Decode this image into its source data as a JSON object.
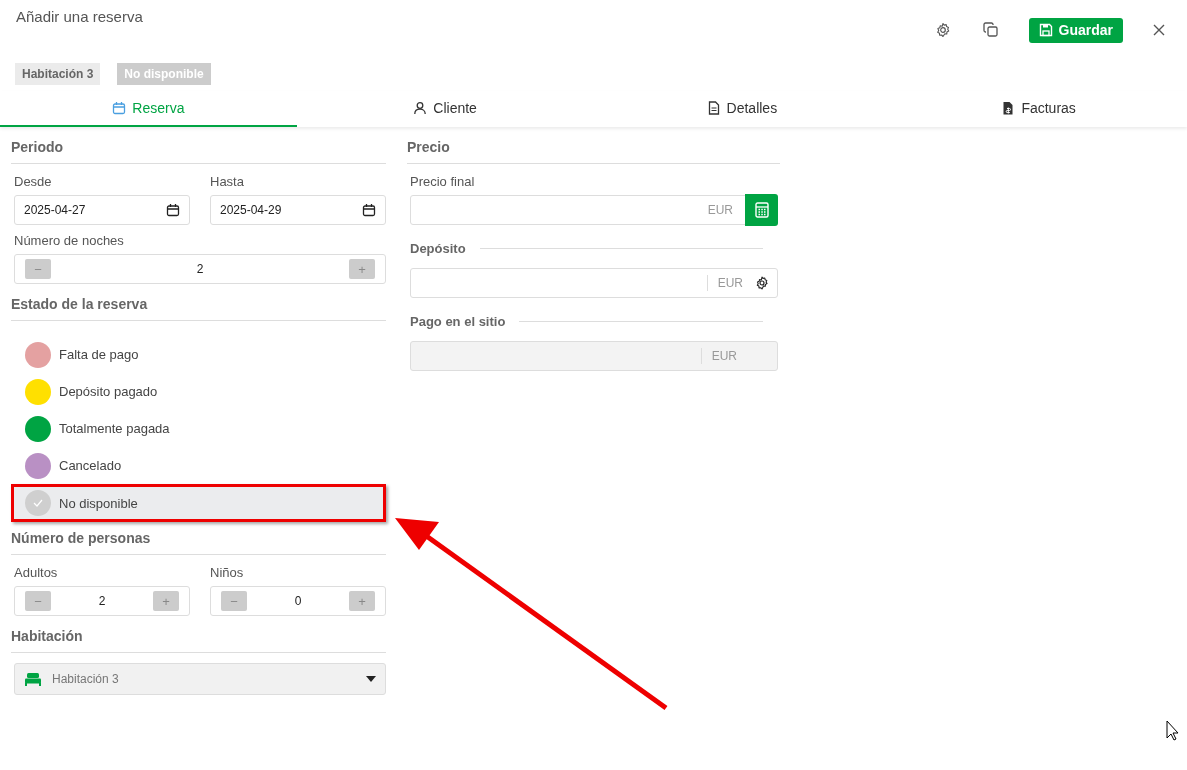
{
  "window": {
    "title": "Añadir una reserva",
    "save_label": "Guardar"
  },
  "tags": [
    {
      "label": "Habitación 3",
      "kind": "room"
    },
    {
      "label": "No disponible",
      "kind": "status"
    }
  ],
  "tabs": [
    {
      "label": "Reserva",
      "selected": true
    },
    {
      "label": "Cliente",
      "selected": false
    },
    {
      "label": "Detalles",
      "selected": false
    },
    {
      "label": "Facturas",
      "selected": false
    }
  ],
  "period": {
    "title": "Periodo",
    "from": {
      "label": "Desde",
      "value": "2025-04-27"
    },
    "to": {
      "label": "Hasta",
      "value": "2025-04-29"
    },
    "nights": {
      "label": "Número de noches",
      "value": "2",
      "minus": "−",
      "plus": "+"
    }
  },
  "status": {
    "title": "Estado de la reserva",
    "options": [
      {
        "label": "Falta de pago",
        "color": "#e4a1a1",
        "selected": false
      },
      {
        "label": "Depósito pagado",
        "color": "#ffe000",
        "selected": false
      },
      {
        "label": "Totalmente pagada",
        "color": "#00a443",
        "selected": false
      },
      {
        "label": "Cancelado",
        "color": "#b990c4",
        "selected": false
      },
      {
        "label": "No disponible",
        "color": "#cfcfcf",
        "selected": true
      }
    ]
  },
  "persons": {
    "title": "Número de personas",
    "counters": [
      {
        "label": "Adultos",
        "value": "2",
        "minus": "−",
        "plus": "+"
      },
      {
        "label": "Niños",
        "value": "0",
        "minus": "−",
        "plus": "+"
      }
    ]
  },
  "room": {
    "title": "Habitación",
    "value": "Habitación 3"
  },
  "price": {
    "title": "Precio",
    "fields": [
      {
        "label": "Precio final",
        "unit": "EUR",
        "kind": "calculator",
        "disabled": false
      },
      {
        "label": "Depósito",
        "unit": "EUR",
        "kind": "settings",
        "disabled": false
      },
      {
        "label": "Pago en el sitio",
        "unit": "EUR",
        "kind": "plain",
        "disabled": true
      }
    ]
  }
}
